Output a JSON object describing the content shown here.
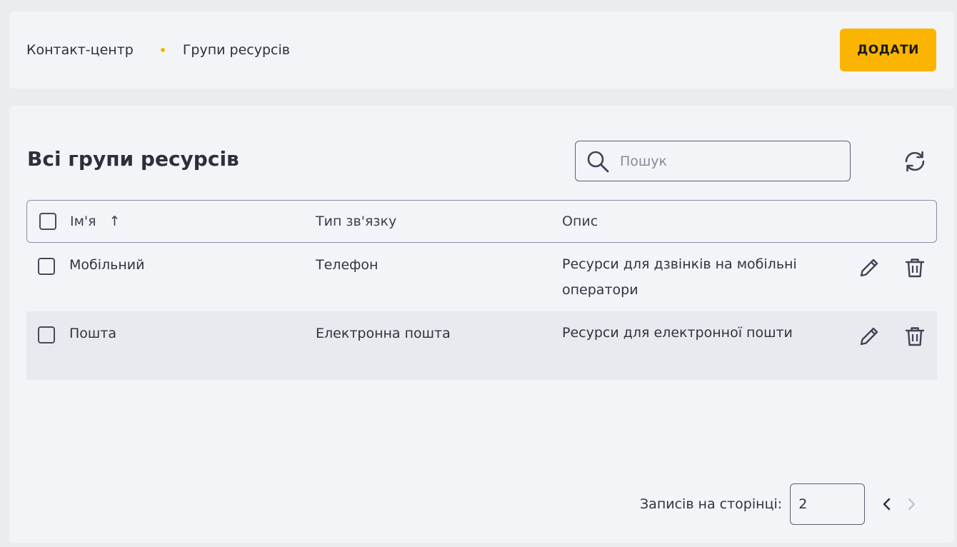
{
  "breadcrumb": {
    "parent": "Контакт-центр",
    "current": "Групи ресурсів"
  },
  "header": {
    "add_label": "ДОДАТИ"
  },
  "main": {
    "title": "Всі групи ресурсів",
    "search": {
      "placeholder": "Пошук",
      "value": ""
    }
  },
  "table": {
    "columns": {
      "name": "Ім'я",
      "type": "Тип зв'язку",
      "description": "Опис"
    },
    "sort_indicator": "↑",
    "rows": [
      {
        "name": "Мобільний",
        "type": "Телефон",
        "description": "Ресурси для дзвінків на мобільні оператори"
      },
      {
        "name": "Пошта",
        "type": "Електронна пошта",
        "description": "Ресурси для електронної пошти"
      }
    ]
  },
  "pagination": {
    "label": "Записів на сторінці:",
    "page_size": "2"
  },
  "icons": [
    "search-icon",
    "refresh-icon",
    "sort-ascending-icon",
    "edit-icon",
    "delete-icon",
    "chevron-left-icon",
    "chevron-right-icon"
  ],
  "colors": {
    "accent": "#fbb400",
    "dot": "#f5b400",
    "background": "#ebecf0",
    "card": "#f3f4f8"
  }
}
